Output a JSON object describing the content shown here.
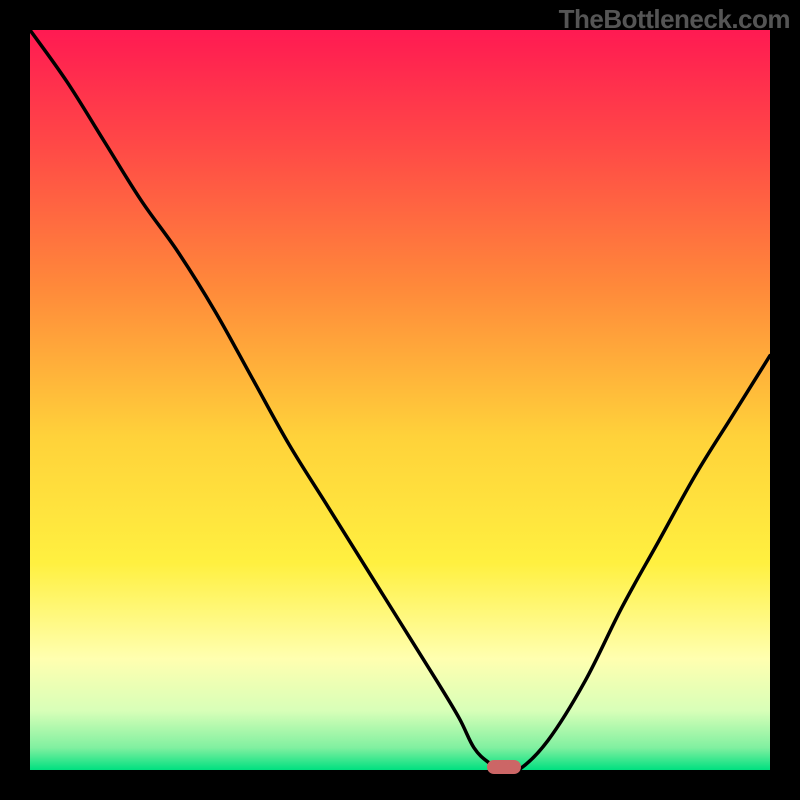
{
  "watermark": "TheBottleneck.com",
  "chart_data": {
    "type": "line",
    "title": "",
    "xlabel": "",
    "ylabel": "",
    "xlim": [
      0,
      100
    ],
    "ylim": [
      0,
      100
    ],
    "x": [
      0,
      5,
      10,
      15,
      20,
      25,
      30,
      35,
      40,
      45,
      50,
      55,
      58,
      60,
      62,
      64,
      66,
      70,
      75,
      80,
      85,
      90,
      95,
      100
    ],
    "values": [
      100,
      93,
      85,
      77,
      70,
      62,
      53,
      44,
      36,
      28,
      20,
      12,
      7,
      3,
      1,
      0,
      0,
      4,
      12,
      22,
      31,
      40,
      48,
      56
    ],
    "marker": {
      "x": 64,
      "y": 0
    },
    "gradient_stops": [
      {
        "offset": 0.0,
        "color": "#ff1a52"
      },
      {
        "offset": 0.15,
        "color": "#ff4747"
      },
      {
        "offset": 0.35,
        "color": "#ff8a3a"
      },
      {
        "offset": 0.55,
        "color": "#ffd23a"
      },
      {
        "offset": 0.72,
        "color": "#fff040"
      },
      {
        "offset": 0.85,
        "color": "#ffffb0"
      },
      {
        "offset": 0.92,
        "color": "#d8ffb8"
      },
      {
        "offset": 0.97,
        "color": "#80f0a0"
      },
      {
        "offset": 1.0,
        "color": "#00e080"
      }
    ]
  }
}
